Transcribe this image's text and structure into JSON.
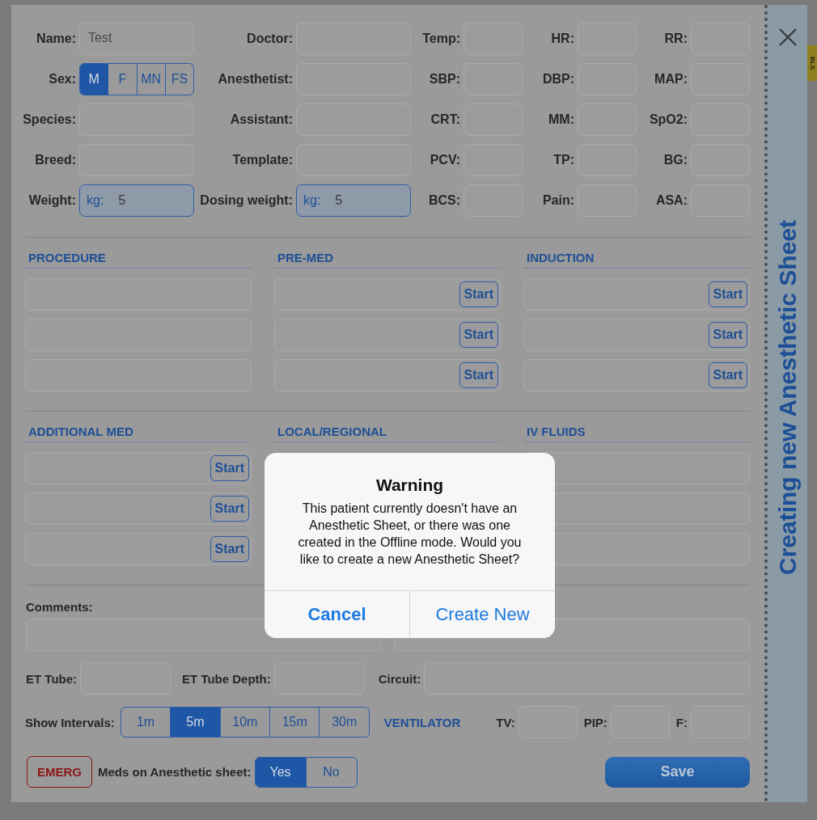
{
  "background_tab": "BLS",
  "patient_grid": [
    [
      {
        "label": "Name:",
        "kind": "text",
        "value": "Test"
      },
      {
        "label": "Doctor:",
        "kind": "text"
      },
      {
        "label": "Temp:",
        "kind": "text"
      },
      {
        "label": "HR:",
        "kind": "text"
      },
      {
        "label": "RR:",
        "kind": "text"
      }
    ],
    [
      {
        "label": "Sex:",
        "kind": "segmented",
        "options": [
          {
            "label": "M",
            "selected": true
          },
          {
            "label": "F",
            "selected": false
          },
          {
            "label": "MN",
            "selected": false
          },
          {
            "label": "FS",
            "selected": false
          }
        ]
      },
      {
        "label": "Anesthetist:",
        "kind": "text"
      },
      {
        "label": "SBP:",
        "kind": "text"
      },
      {
        "label": "DBP:",
        "kind": "text"
      },
      {
        "label": "MAP:",
        "kind": "text"
      }
    ],
    [
      {
        "label": "Species:",
        "kind": "text"
      },
      {
        "label": "Assistant:",
        "kind": "text"
      },
      {
        "label": "CRT:",
        "kind": "text"
      },
      {
        "label": "MM:",
        "kind": "text"
      },
      {
        "label": "SpO2:",
        "kind": "text"
      }
    ],
    [
      {
        "label": "Breed:",
        "kind": "text"
      },
      {
        "label": "Template:",
        "kind": "text"
      },
      {
        "label": "PCV:",
        "kind": "text"
      },
      {
        "label": "TP:",
        "kind": "text"
      },
      {
        "label": "BG:",
        "kind": "text"
      }
    ],
    [
      {
        "label": "Weight:",
        "kind": "unit",
        "unit": "kg:",
        "value": "5"
      },
      {
        "label": "Dosing weight:",
        "kind": "unit",
        "unit": "kg:",
        "value": "5"
      },
      {
        "label": "BCS:",
        "kind": "text"
      },
      {
        "label": "Pain:",
        "kind": "text"
      },
      {
        "label": "ASA:",
        "kind": "text"
      }
    ]
  ],
  "med_sections": [
    {
      "title": "PROCEDURE",
      "rows": [
        {
          "kind": "field"
        },
        {
          "kind": "field"
        },
        {
          "kind": "field"
        }
      ]
    },
    {
      "title": "PRE-MED",
      "rows": [
        {
          "kind": "start",
          "button": "Start"
        },
        {
          "kind": "start",
          "button": "Start"
        },
        {
          "kind": "start",
          "button": "Start"
        }
      ]
    },
    {
      "title": "INDUCTION",
      "rows": [
        {
          "kind": "start",
          "button": "Start"
        },
        {
          "kind": "start",
          "button": "Start"
        },
        {
          "kind": "start",
          "button": "Start"
        }
      ]
    },
    {
      "title": "ADDITIONAL MED",
      "rows": [
        {
          "kind": "start",
          "button": "Start"
        },
        {
          "kind": "start",
          "button": "Start"
        },
        {
          "kind": "start",
          "button": "Start"
        }
      ]
    },
    {
      "title": "LOCAL/REGIONAL"
    },
    {
      "title": "IV FLUIDS",
      "rows": [
        {
          "kind": "field"
        },
        {
          "kind": "field"
        },
        {
          "kind": "field"
        }
      ]
    }
  ],
  "comments": {
    "label": "Comments:"
  },
  "airway": [
    {
      "label": "ET Tube:"
    },
    {
      "label": "ET Tube Depth:"
    },
    {
      "label": "Circuit:"
    }
  ],
  "intervals": {
    "label": "Show Intervals:",
    "options": [
      {
        "label": "1m",
        "selected": false
      },
      {
        "label": "5m",
        "selected": true
      },
      {
        "label": "10m",
        "selected": false
      },
      {
        "label": "15m",
        "selected": false
      },
      {
        "label": "30m",
        "selected": false
      }
    ]
  },
  "ventilator": {
    "title": "VENTILATOR",
    "fields": [
      {
        "label": "TV:"
      },
      {
        "label": "PIP:"
      },
      {
        "label": "F:"
      }
    ]
  },
  "emerg_button": "EMERG",
  "meds_on_sheet": {
    "label": "Meds on Anesthetic sheet:",
    "options": [
      {
        "label": "Yes",
        "selected": true
      },
      {
        "label": "No",
        "selected": false
      }
    ]
  },
  "save_button": "Save",
  "side_panel": {
    "title": "Creating new Anesthetic Sheet"
  },
  "dialog": {
    "title": "Warning",
    "message": "This patient currently doesn't have an Anesthetic Sheet, or there was one created in the Offline mode. Would you like to create a new Anesthetic Sheet?",
    "buttons": [
      {
        "label": "Cancel",
        "kind": "cancel"
      },
      {
        "label": "Create New",
        "kind": "default"
      }
    ]
  }
}
